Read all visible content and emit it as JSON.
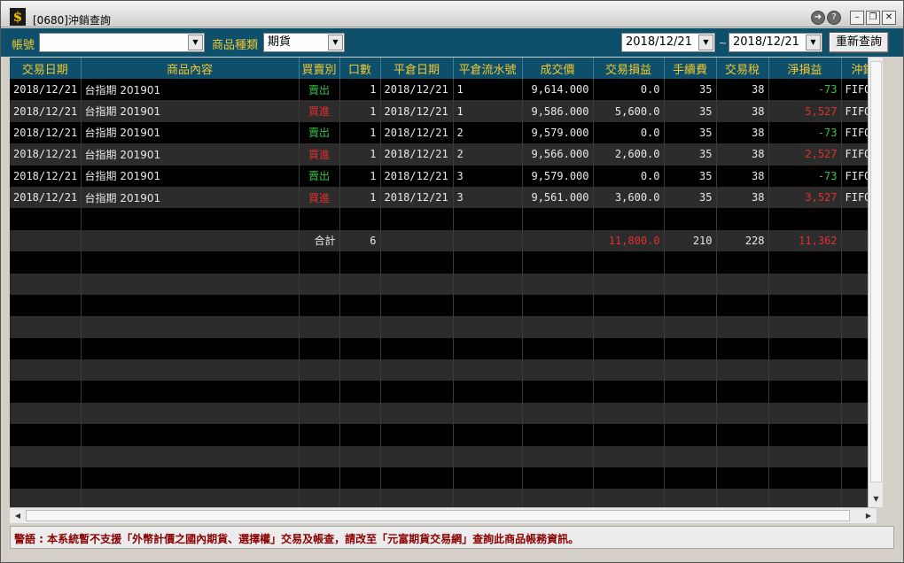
{
  "window": {
    "title": "[0680]沖銷查詢"
  },
  "toolbar": {
    "account_label": "帳號",
    "account_value": "",
    "product_type_label": "商品種類",
    "product_type_value": "期貨",
    "date_from": "2018/12/21",
    "date_sep": "~",
    "date_to": "2018/12/21",
    "requery_label": "重新查詢"
  },
  "table": {
    "columns": [
      "交易日期",
      "商品內容",
      "買賣別",
      "口數",
      "平倉日期",
      "平倉流水號",
      "成交價",
      "交易損益",
      "手續費",
      "交易稅",
      "淨損益",
      "沖銷類"
    ],
    "rows": [
      {
        "trade_date": "2018/12/21",
        "product": "台指期 201901",
        "side": "賣出",
        "lots": "1",
        "close_date": "2018/12/21",
        "close_seq": "1",
        "price": "9,614.000",
        "trade_pl": "0.0",
        "fee": "35",
        "tax": "38",
        "net_pl": "-73",
        "method": "FIFO"
      },
      {
        "trade_date": "2018/12/21",
        "product": "台指期 201901",
        "side": "買進",
        "lots": "1",
        "close_date": "2018/12/21",
        "close_seq": "1",
        "price": "9,586.000",
        "trade_pl": "5,600.0",
        "fee": "35",
        "tax": "38",
        "net_pl": "5,527",
        "method": "FIFO"
      },
      {
        "trade_date": "2018/12/21",
        "product": "台指期 201901",
        "side": "賣出",
        "lots": "1",
        "close_date": "2018/12/21",
        "close_seq": "2",
        "price": "9,579.000",
        "trade_pl": "0.0",
        "fee": "35",
        "tax": "38",
        "net_pl": "-73",
        "method": "FIFO"
      },
      {
        "trade_date": "2018/12/21",
        "product": "台指期 201901",
        "side": "買進",
        "lots": "1",
        "close_date": "2018/12/21",
        "close_seq": "2",
        "price": "9,566.000",
        "trade_pl": "2,600.0",
        "fee": "35",
        "tax": "38",
        "net_pl": "2,527",
        "method": "FIFO"
      },
      {
        "trade_date": "2018/12/21",
        "product": "台指期 201901",
        "side": "賣出",
        "lots": "1",
        "close_date": "2018/12/21",
        "close_seq": "3",
        "price": "9,579.000",
        "trade_pl": "0.0",
        "fee": "35",
        "tax": "38",
        "net_pl": "-73",
        "method": "FIFO"
      },
      {
        "trade_date": "2018/12/21",
        "product": "台指期 201901",
        "side": "買進",
        "lots": "1",
        "close_date": "2018/12/21",
        "close_seq": "3",
        "price": "9,561.000",
        "trade_pl": "3,600.0",
        "fee": "35",
        "tax": "38",
        "net_pl": "3,527",
        "method": "FIFO"
      }
    ],
    "total": {
      "label": "合計",
      "lots": "6",
      "trade_pl": "11,800.0",
      "fee": "210",
      "tax": "228",
      "net_pl": "11,362"
    }
  },
  "status": {
    "warning": "警語 : 本系統暫不支援「外幣計價之國內期貨、選擇權」交易及帳查，請改至「元富期貨交易網」查詢此商品帳務資訊。"
  },
  "colors": {
    "header_bg": "#0e4f6b",
    "header_text": "#f0c830",
    "sell": "#39c24a",
    "buy": "#e0302e"
  }
}
